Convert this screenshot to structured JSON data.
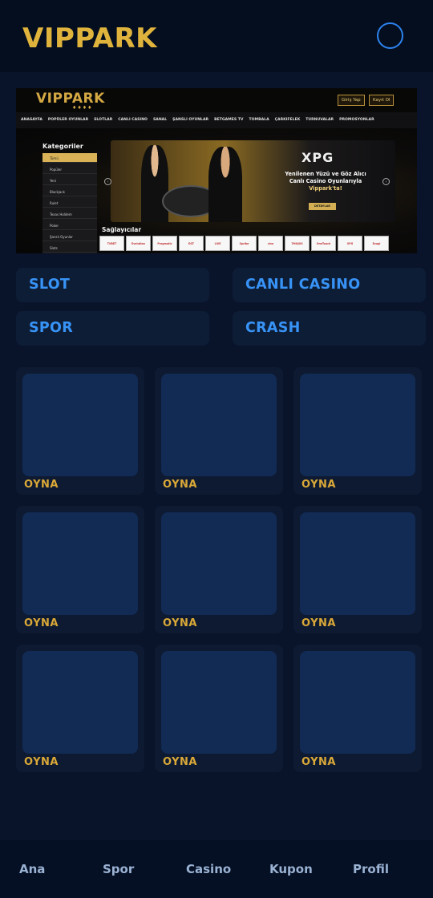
{
  "header": {
    "title": "VIPPARK",
    "menu_icon": "menu-ring-icon"
  },
  "banner": {
    "logo": "VIPPARK",
    "logo_sub": "♦♦♦♦",
    "buttons": [
      "Giriş Yap",
      "Kayıt Ol"
    ],
    "nav": [
      "ANASAYFA",
      "POPÜLER OYUNLAR",
      "SLOTLAR",
      "CANLI CASINO",
      "SANAL",
      "ŞANSLI OYUNLAR",
      "BETGAMES TV",
      "TOMBALA",
      "ÇARKIFELEK",
      "TURNUVALAR",
      "PROMOSYONLAR"
    ],
    "categories_title": "Kategoriler",
    "categories": [
      "Tümü",
      "Popüler",
      "Yeni",
      "Blackjack",
      "Rulet",
      "Texas Holdem",
      "Poker",
      "Şanslı Oyunlar",
      "Slots"
    ],
    "promo_brand": "XPG",
    "promo_line1": "Yenilenen Yüzü ve Göz Alıcı",
    "promo_line2": "Canlı Casino Oyunlarıyla",
    "promo_line3": "Vippark'ta!",
    "promo_button": "DETAYLAR",
    "providers_title": "Sağlayıcılar",
    "providers": [
      "TVBET",
      "Evolution",
      "Pragmatic",
      "EGT",
      "LIVE",
      "Spribe",
      "vivo",
      "7MOJOS",
      "OneTouch",
      "XPG",
      "Ezugi"
    ]
  },
  "categories": {
    "slot": "SLOT",
    "canli_casino": "CANLI CASINO",
    "spor": "SPOR",
    "crash": "CRASH"
  },
  "games": {
    "play_label": "OYNA",
    "cards": [
      "OYNA",
      "OYNA",
      "OYNA",
      "OYNA",
      "OYNA",
      "OYNA",
      "OYNA",
      "OYNA",
      "OYNA"
    ]
  },
  "bottom_nav": {
    "items": [
      "Ana",
      "Spor",
      "Casino",
      "Kupon",
      "Profil"
    ]
  },
  "colors": {
    "background": "#09142a",
    "accent_gold": "#e0b43c",
    "accent_blue": "#3793f6",
    "card": "#0e1a31"
  }
}
